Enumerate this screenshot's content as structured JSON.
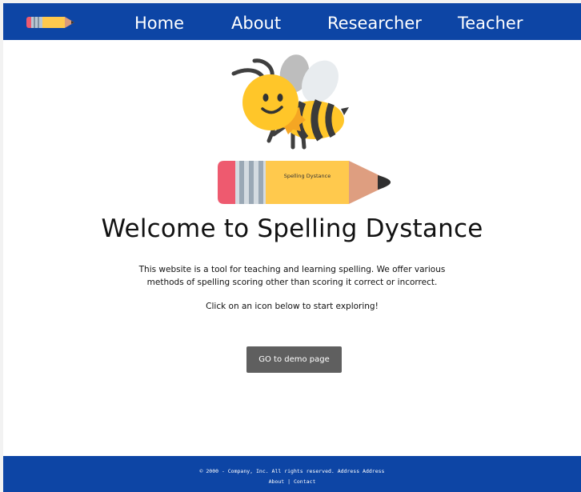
{
  "nav": {
    "items": [
      {
        "label": "Home"
      },
      {
        "label": "About"
      },
      {
        "label": "Researcher"
      },
      {
        "label": "Teacher"
      }
    ]
  },
  "hero": {
    "pencil_label": "Spelling Dystance",
    "title": "Welcome to Spelling Dystance",
    "intro": "This website is a tool for teaching and learning spelling. We offer various methods of spelling scoring other than scoring it correct or incorrect.",
    "cta": "Click on an icon below to start exploring!",
    "button_label": "GO to demo page"
  },
  "footer": {
    "copyright": "© 2000 - Company, Inc. All rights reserved. Address Address",
    "links": [
      {
        "label": "About"
      },
      {
        "label": "Contact"
      }
    ],
    "separator": "|"
  },
  "colors": {
    "navbar": "#0d45a5",
    "footer": "#0d45a5",
    "button": "#5f5f5f",
    "pencil_body": "#ffc94d",
    "pencil_eraser": "#ee5a6f"
  },
  "icons": [
    "pencil-logo-icon",
    "bee-icon",
    "pencil-icon"
  ]
}
